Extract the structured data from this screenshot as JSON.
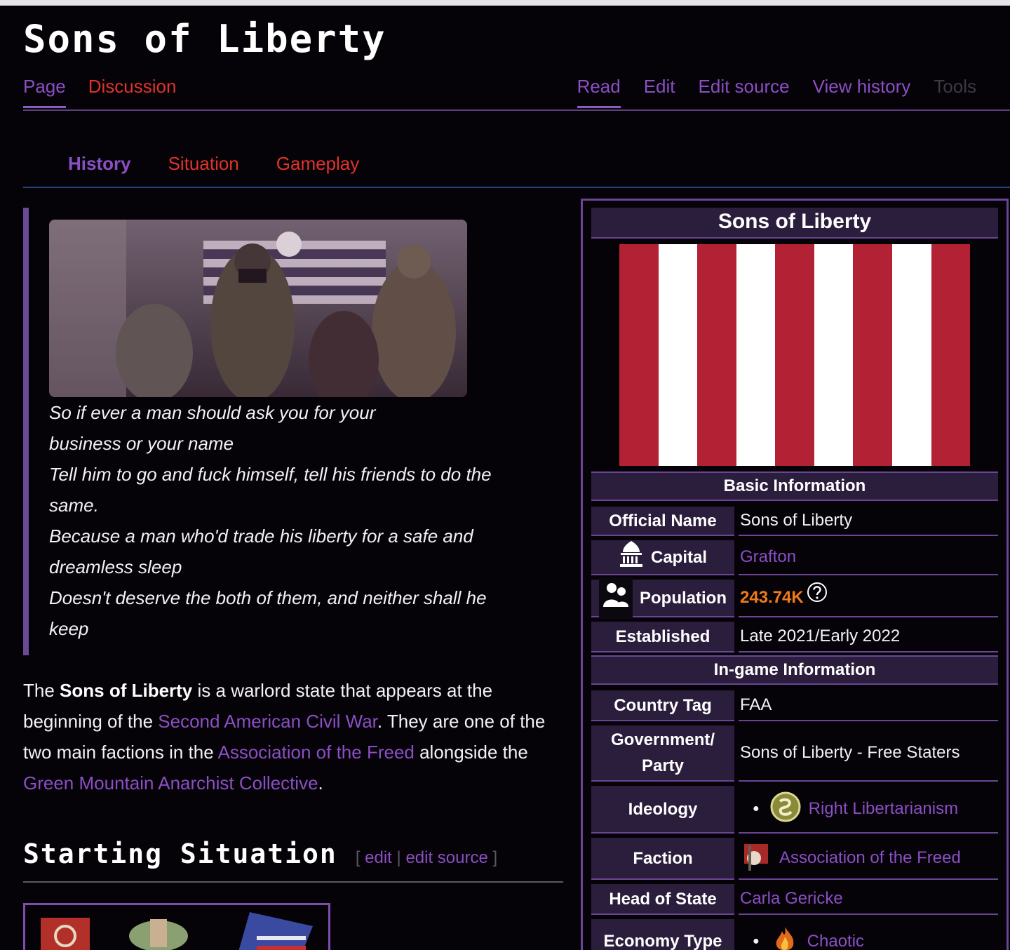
{
  "page": {
    "title": "Sons of Liberty",
    "tabs_left": [
      {
        "label": "Page",
        "active": true
      },
      {
        "label": "Discussion",
        "active": false
      }
    ],
    "tabs_right": [
      {
        "label": "Read",
        "active": true
      },
      {
        "label": "Edit"
      },
      {
        "label": "Edit source"
      },
      {
        "label": "View history"
      },
      {
        "label": "Tools"
      }
    ],
    "subnav": [
      "History",
      "Situation",
      "Gameplay"
    ]
  },
  "quote": {
    "lines": [
      "So if ever a man should ask you for your",
      "business or your name",
      "Tell him to go and fuck himself, tell his friends to do the",
      "same.",
      "Because a man who'd trade his liberty for a safe and",
      "dreamless sleep",
      "Doesn't deserve the both of them, and neither shall he",
      "keep"
    ]
  },
  "intro": {
    "t1": "The ",
    "bold": "Sons of Liberty",
    "t2": " is a warlord state that appears at the beginning of the ",
    "link1": "Second American Civil War",
    "t3": ". They are one of the two main factions in the ",
    "link2": "Association of the Freed",
    "t4": " alongside the ",
    "link3": "Green Mountain Anarchist Collective",
    "t5": "."
  },
  "section": {
    "heading": "Starting Situation",
    "open": "[",
    "edit": "edit",
    "sep": "|",
    "edit_source": "edit source",
    "close": "]"
  },
  "infobox": {
    "title": "Sons of Liberty",
    "flag_colors": [
      "#b22234",
      "#ffffff"
    ],
    "basic_header": "Basic Information",
    "official_name_label": "Official Name",
    "official_name": "Sons of Liberty",
    "capital_label": "Capital",
    "capital": "Grafton",
    "population_label": "Population",
    "population": "243.74K",
    "established_label": "Established",
    "established": "Late 2021/Early 2022",
    "ingame_header": "In-game Information",
    "tag_label": "Country Tag",
    "tag": "FAA",
    "gov_label": "Government/ Party",
    "gov": "Sons of Liberty - Free Staters",
    "ideology_label": "Ideology",
    "ideology": "Right Libertarianism",
    "faction_label": "Faction",
    "faction": "Association of the Freed",
    "hos_label": "Head of State",
    "hos": "Carla Gericke",
    "economy_label": "Economy Type",
    "economy": "Chaotic"
  }
}
